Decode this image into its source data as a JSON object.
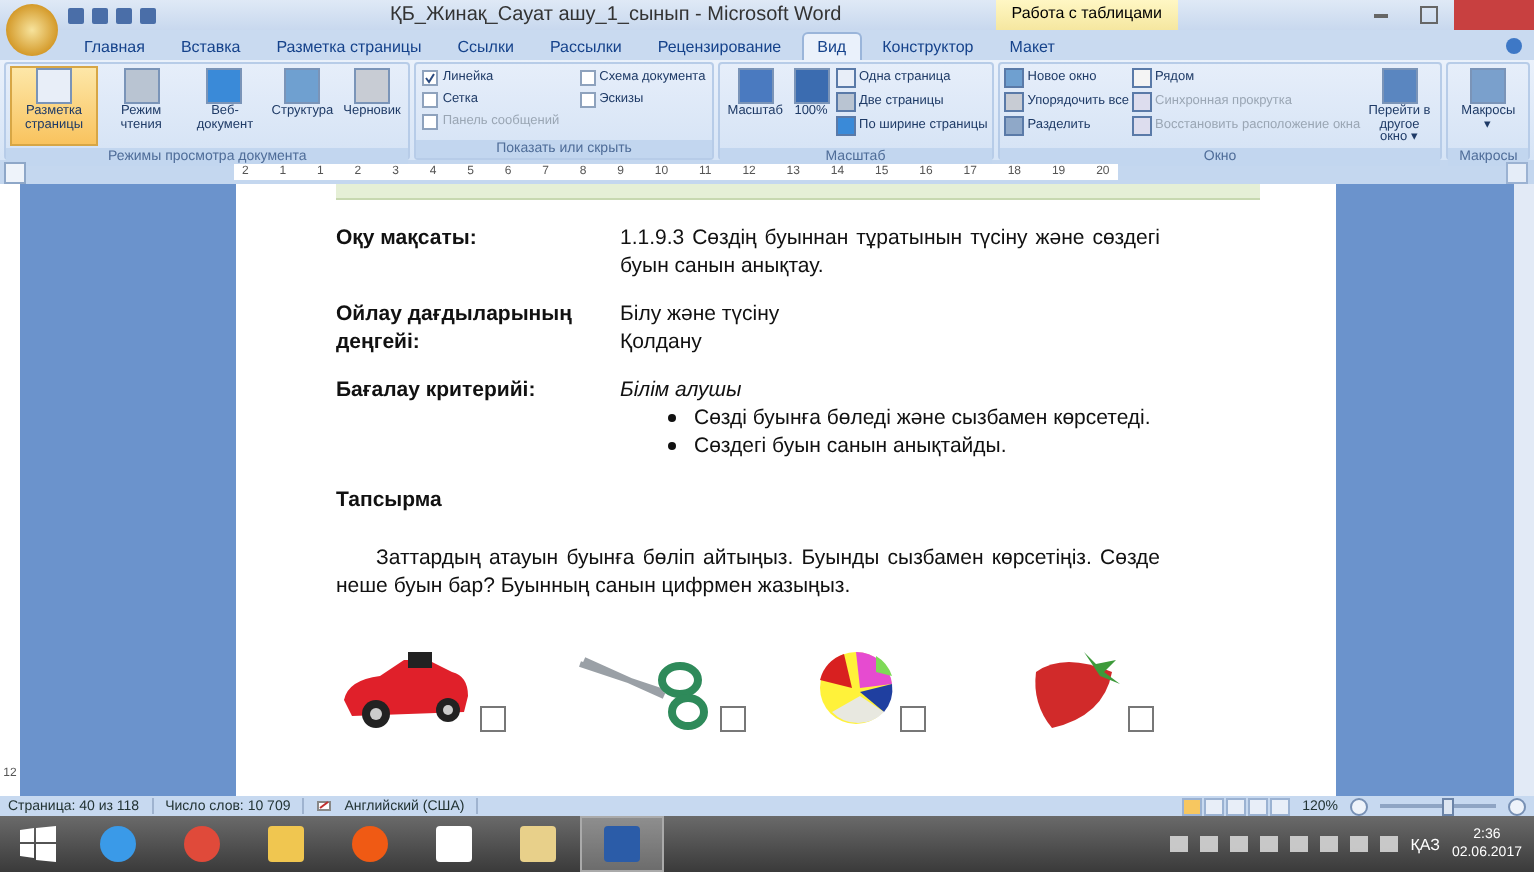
{
  "window": {
    "title": "ҚБ_Жинақ_Сауат ашу_1_сынып - Microsoft Word",
    "context_label": "Работа с таблицами"
  },
  "tabs": [
    {
      "label": "Главная",
      "selected": false
    },
    {
      "label": "Вставка",
      "selected": false
    },
    {
      "label": "Разметка страницы",
      "selected": false
    },
    {
      "label": "Ссылки",
      "selected": false
    },
    {
      "label": "Рассылки",
      "selected": false
    },
    {
      "label": "Рецензирование",
      "selected": false
    },
    {
      "label": "Вид",
      "selected": true
    },
    {
      "label": "Конструктор",
      "selected": false
    },
    {
      "label": "Макет",
      "selected": false
    }
  ],
  "ribbon": [
    {
      "kind": "buttons",
      "label": "Режимы просмотра документа",
      "items": [
        {
          "kind": "large",
          "label": "Разметка страницы",
          "selected": true
        },
        {
          "kind": "large",
          "label": "Режим чтения",
          "selected": false
        },
        {
          "kind": "large",
          "label": "Веб-документ",
          "selected": false
        },
        {
          "kind": "large",
          "label": "Структура",
          "selected": false
        },
        {
          "kind": "large",
          "label": "Черновик",
          "selected": false
        }
      ]
    },
    {
      "kind": "checks",
      "label": "Показать или скрыть",
      "items": [
        {
          "kind": "check",
          "label": "Линейка",
          "checked": true,
          "disabled": false
        },
        {
          "kind": "check",
          "label": "Сетка",
          "checked": false,
          "disabled": false
        },
        {
          "kind": "check",
          "label": "Панель сообщений",
          "checked": false,
          "disabled": true
        },
        {
          "kind": "check",
          "label": "Схема документа",
          "checked": false,
          "disabled": false
        },
        {
          "kind": "check",
          "label": "Эскизы",
          "checked": false,
          "disabled": false
        }
      ]
    },
    {
      "kind": "buttons",
      "label": "Масштаб",
      "items": [
        {
          "kind": "large",
          "label": "Масштаб",
          "selected": false
        },
        {
          "kind": "large",
          "label": "100%",
          "selected": false
        },
        {
          "kind": "small",
          "label": "Одна страница",
          "disabled": false
        },
        {
          "kind": "small",
          "label": "Две страницы",
          "disabled": false
        },
        {
          "kind": "small",
          "label": "По ширине страницы",
          "disabled": false
        }
      ]
    },
    {
      "kind": "buttons",
      "label": "Окно",
      "items": [
        {
          "kind": "small",
          "label": "Новое окно",
          "disabled": false
        },
        {
          "kind": "small",
          "label": "Упорядочить все",
          "disabled": false
        },
        {
          "kind": "small",
          "label": "Разделить",
          "disabled": false
        },
        {
          "kind": "small",
          "label": "Рядом",
          "disabled": false
        },
        {
          "kind": "small",
          "label": "Синхронная прокрутка",
          "disabled": true
        },
        {
          "kind": "small",
          "label": "Восстановить расположение окна",
          "disabled": true
        },
        {
          "kind": "large",
          "label": "Перейти в другое окно ▾",
          "selected": false
        }
      ]
    },
    {
      "kind": "buttons",
      "label": "Макросы",
      "items": [
        {
          "kind": "large",
          "label": "Макросы ▾",
          "selected": false
        }
      ]
    }
  ],
  "ruler": [
    "2",
    "1",
    "1",
    "2",
    "3",
    "4",
    "5",
    "6",
    "7",
    "8",
    "9",
    "10",
    "11",
    "12",
    "13",
    "14",
    "15",
    "16",
    "17",
    "18",
    "19",
    "20"
  ],
  "vertical_ruler": [
    "12"
  ],
  "document": {
    "rows": [
      {
        "label": "Оқу мақсаты:",
        "lines": [
          {
            "kind": "justify",
            "text": "1.1.9.3 Сөздің буыннан тұратынын түсіну және сөздегі буын санын анықтау."
          }
        ]
      },
      {
        "label": "Ойлау дағдыларының деңгейі:",
        "lines": [
          {
            "kind": "plain",
            "text": "Білу және түсіну"
          },
          {
            "kind": "plain",
            "text": "Қолдану"
          }
        ]
      },
      {
        "label": "Бағалау критерийі:",
        "lines": [
          {
            "kind": "italic",
            "text": "Білім алушы"
          },
          {
            "kind": "bullet",
            "text": "Сөзді буынға бөледі және сызбамен көрсетеді."
          },
          {
            "kind": "bullet",
            "text": "Сөздегі буын санын анықтайды."
          }
        ]
      }
    ],
    "task_heading": "Тапсырма",
    "task_text": "Заттардың атауын буынға бөліп айтыңыз. Буынды сызбамен көрсетіңіз. Сөзде неше буын бар? Буынның санын цифрмен жазыңыз.",
    "pictures": [
      {
        "kind": "car"
      },
      {
        "kind": "scissors"
      },
      {
        "kind": "ball"
      },
      {
        "kind": "strawberry"
      }
    ]
  },
  "status_bar": {
    "page": "Страница: 40 из 118",
    "words": "Число слов: 10 709",
    "language": "Английский (США)",
    "zoom": "120%",
    "level": 0.58
  },
  "taskbar": {
    "apps": [
      {
        "selected": false
      },
      {
        "selected": false
      },
      {
        "selected": false
      },
      {
        "selected": false
      },
      {
        "selected": false
      },
      {
        "selected": false
      },
      {
        "selected": true
      }
    ],
    "language": "ҚАЗ",
    "time": "2:36",
    "date": "02.06.2017"
  }
}
